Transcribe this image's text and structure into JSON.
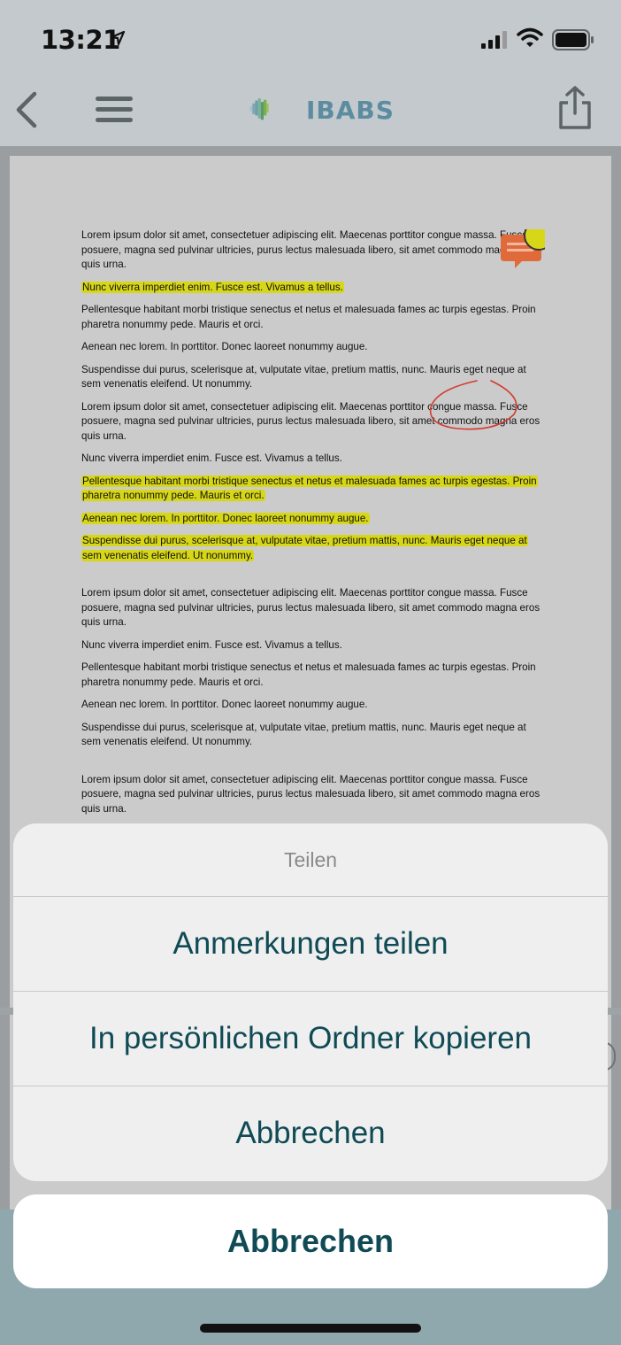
{
  "status_bar": {
    "time": "13:21"
  },
  "nav": {
    "logo_text": "IBABS"
  },
  "document": {
    "paragraphs": [
      "Lorem ipsum dolor sit amet, consectetuer adipiscing elit. Maecenas porttitor congue massa. Fusce posuere, magna sed pulvinar ultricies, purus lectus malesuada libero, sit amet commodo magna eros quis urna.",
      "Nunc viverra imperdiet enim. Fusce est. Vivamus a tellus.",
      "Pellentesque habitant morbi tristique senectus et netus et malesuada fames ac turpis egestas. Proin pharetra nonummy pede. Mauris et orci.",
      "Aenean nec lorem. In porttitor. Donec laoreet nonummy augue.",
      "Suspendisse dui purus, scelerisque at, vulputate vitae, pretium mattis, nunc. Mauris eget neque at sem venenatis eleifend. Ut nonummy.",
      "Lorem ipsum dolor sit amet, consectetuer adipiscing elit. Maecenas porttitor congue massa. Fusce posuere, magna sed pulvinar ultricies, purus lectus malesuada libero, sit amet commodo magna eros quis urna.",
      "Nunc viverra imperdiet enim. Fusce est. Vivamus a tellus.",
      "Pellentesque habitant morbi tristique senectus et netus et malesuada fames ac turpis egestas. Proin pharetra nonummy pede. Mauris et orci.",
      "Aenean nec lorem. In porttitor. Donec laoreet nonummy augue.",
      "Suspendisse dui purus, scelerisque at, vulputate vitae, pretium mattis, nunc. Mauris eget neque at sem venenatis eleifend. Ut nonummy.",
      "Lorem ipsum dolor sit amet, consectetuer adipiscing elit. Maecenas porttitor congue massa. Fusce posuere, magna sed pulvinar ultricies, purus lectus malesuada libero, sit amet commodo magna eros quis urna.",
      "Nunc viverra imperdiet enim. Fusce est. Vivamus a tellus.",
      "Pellentesque habitant morbi tristique senectus et netus et malesuada fames ac turpis egestas. Proin pharetra nonummy pede. Mauris et orci.",
      "Aenean nec lorem. In porttitor. Donec laoreet nonummy augue.",
      "Suspendisse dui purus, scelerisque at, vulputate vitae, pretium mattis, nunc. Mauris eget neque at sem venenatis eleifend. Ut nonummy.",
      "Lorem ipsum dolor sit amet, consectetuer adipiscing elit. Maecenas porttitor congue massa. Fusce posuere, magna sed pulvinar ultricies, purus lectus malesuada libero, sit amet commodo magna eros quis urna."
    ]
  },
  "action_sheet": {
    "title": "Teilen",
    "actions": [
      "Anmerkungen teilen",
      "In persönlichen Ordner kopieren",
      "Abbrechen"
    ],
    "cancel": "Abbrechen"
  },
  "colors": {
    "highlight": "#d7d718",
    "action_text": "#0f4a55",
    "note_marker": "#e06a3a",
    "ink_stroke": "#d43a30"
  }
}
